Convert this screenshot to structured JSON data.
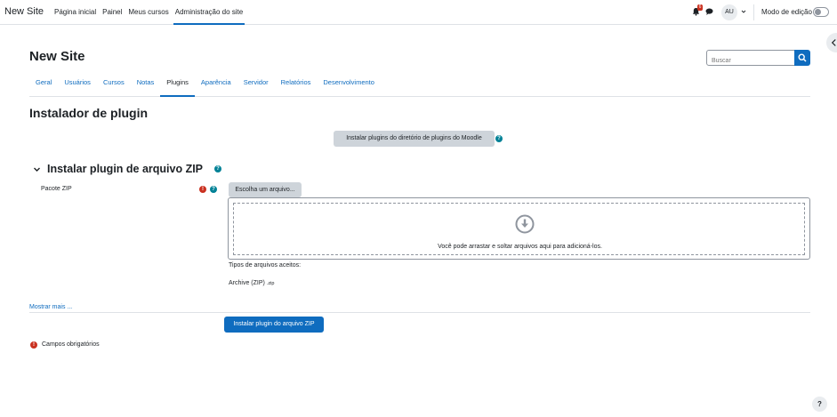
{
  "navbar": {
    "brand": "New Site",
    "items": [
      {
        "label": "Página inicial",
        "active": false
      },
      {
        "label": "Painel",
        "active": false
      },
      {
        "label": "Meus cursos",
        "active": false
      },
      {
        "label": "Administração do site",
        "active": true
      }
    ],
    "notification_count": "6",
    "avatar_initials": "AU",
    "edit_mode_label": "Modo de edição",
    "edit_mode_on": false
  },
  "header": {
    "site_title": "New Site",
    "search_placeholder": "Buscar"
  },
  "tabs": [
    {
      "label": "Geral",
      "active": false
    },
    {
      "label": "Usuários",
      "active": false
    },
    {
      "label": "Cursos",
      "active": false
    },
    {
      "label": "Notas",
      "active": false
    },
    {
      "label": "Plugins",
      "active": true
    },
    {
      "label": "Aparência",
      "active": false
    },
    {
      "label": "Servidor",
      "active": false
    },
    {
      "label": "Relatórios",
      "active": false
    },
    {
      "label": "Desenvolvimento",
      "active": false
    }
  ],
  "main": {
    "title": "Instalador de plugin",
    "install_from_directory_label": "Instalar plugins do diretório de plugins do Moodle",
    "zip_section_title": "Instalar plugin de arquivo ZIP",
    "zip_package_label": "Pacote ZIP",
    "choose_file_label": "Escolha um arquivo...",
    "dropzone_text": "Você pode arrastar e soltar arquivos aqui para adicioná-los.",
    "accepted_types_label": "Tipos de arquivos aceitos:",
    "accepted_type_name": "Archive (ZIP)",
    "accepted_type_ext": ".zip",
    "show_more_label": "Mostrar mais ...",
    "install_zip_button": "Instalar plugin do arquivo ZIP",
    "required_fields_note": "Campos obrigatórios"
  },
  "icons": {
    "help": "?",
    "required": "!"
  },
  "colors": {
    "primary": "#0f6cbf",
    "danger": "#ca3120",
    "info": "#008196",
    "secondary_button": "#ced4da"
  }
}
